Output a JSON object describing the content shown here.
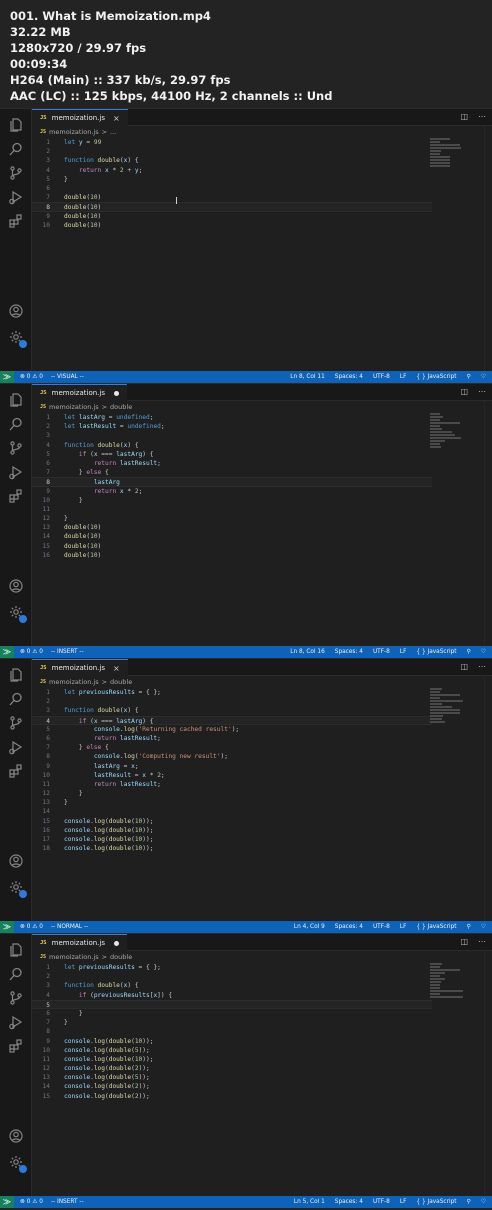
{
  "header": {
    "lines": [
      "001. What is Memoization.mp4",
      "32.22 MB",
      "1280x720 / 29.97 fps",
      "00:09:34",
      "H264 (Main) :: 337 kb/s, 29.97 fps",
      "AAC (LC) :: 125 kbps, 44100 Hz, 2 channels :: Und"
    ]
  },
  "colors": {
    "status_bar": "#0e62b8",
    "remote_indicator": "#16825d",
    "editor_bg": "#1f1f1f",
    "activity_bar": "#181818",
    "keyword": "#569cd6",
    "function": "#dcdcaa",
    "string": "#ce9178",
    "number": "#b5cea8",
    "variable": "#9cdcfe",
    "control": "#c586c0"
  },
  "activity_icons": [
    "files-icon",
    "search-icon",
    "source-control-icon",
    "run-debug-icon",
    "extensions-icon",
    "account-icon",
    "settings-gear-icon"
  ],
  "panels": [
    {
      "tab": {
        "icon": "JS",
        "filename": "memoization.js",
        "modified": false,
        "close": "×"
      },
      "breadcrumb": {
        "file": "memoization.js",
        "sep": ">",
        "symbol": "..."
      },
      "lines": [
        {
          "n": "1",
          "text": "let y = 99"
        },
        {
          "n": "2",
          "text": ""
        },
        {
          "n": "3",
          "text": "function double(x) {"
        },
        {
          "n": "4",
          "text": "    return x * 2 + y;"
        },
        {
          "n": "5",
          "text": "}"
        },
        {
          "n": "6",
          "text": ""
        },
        {
          "n": "7",
          "text": "double(10)"
        },
        {
          "n": "8",
          "text": "double(10)"
        },
        {
          "n": "9",
          "text": "double(10)"
        },
        {
          "n": "10",
          "text": "double(10)"
        }
      ],
      "active_line": 8,
      "status": {
        "mode": "-- VISUAL --",
        "problems": "⊗ 0 ⚠ 0",
        "position": "Ln 8, Col 11",
        "spaces": "Spaces: 4",
        "encoding": "UTF-8",
        "eol": "LF",
        "language": "{ } JavaScript"
      }
    },
    {
      "tab": {
        "icon": "JS",
        "filename": "memoization.js",
        "modified": true,
        "close": ""
      },
      "breadcrumb": {
        "file": "memoization.js",
        "sep": ">",
        "symbol": "double"
      },
      "lines": [
        {
          "n": "1",
          "text": "let lastArg = undefined;"
        },
        {
          "n": "2",
          "text": "let lastResult = undefined;"
        },
        {
          "n": "3",
          "text": ""
        },
        {
          "n": "4",
          "text": "function double(x) {"
        },
        {
          "n": "5",
          "text": "    if (x === lastArg) {"
        },
        {
          "n": "6",
          "text": "        return lastResult;"
        },
        {
          "n": "7",
          "text": "    } else {"
        },
        {
          "n": "8",
          "text": "        lastArg"
        },
        {
          "n": "9",
          "text": "        return x * 2;"
        },
        {
          "n": "10",
          "text": "    }"
        },
        {
          "n": "11",
          "text": ""
        },
        {
          "n": "12",
          "text": "}"
        },
        {
          "n": "13",
          "text": "double(10)"
        },
        {
          "n": "14",
          "text": "double(10)"
        },
        {
          "n": "15",
          "text": "double(10)"
        },
        {
          "n": "16",
          "text": "double(10)"
        }
      ],
      "active_line": 8,
      "status": {
        "mode": "-- INSERT --",
        "problems": "⊗ 0 ⚠ 0",
        "position": "Ln 8, Col 16",
        "spaces": "Spaces: 4",
        "encoding": "UTF-8",
        "eol": "LF",
        "language": "{ } JavaScript"
      }
    },
    {
      "tab": {
        "icon": "JS",
        "filename": "memoization.js",
        "modified": false,
        "close": "×"
      },
      "breadcrumb": {
        "file": "memoization.js",
        "sep": ">",
        "symbol": "double"
      },
      "lines": [
        {
          "n": "1",
          "text": "let previousResults = { };"
        },
        {
          "n": "2",
          "text": ""
        },
        {
          "n": "3",
          "text": "function double(x) {"
        },
        {
          "n": "4",
          "text": "    if (x === lastArg) {"
        },
        {
          "n": "5",
          "text": "        console.log('Returning cached result');"
        },
        {
          "n": "6",
          "text": "        return lastResult;"
        },
        {
          "n": "7",
          "text": "    } else {"
        },
        {
          "n": "8",
          "text": "        console.log('Computing new result');"
        },
        {
          "n": "9",
          "text": "        lastArg = x;"
        },
        {
          "n": "10",
          "text": "        lastResult = x * 2;"
        },
        {
          "n": "11",
          "text": "        return lastResult;"
        },
        {
          "n": "12",
          "text": "    }"
        },
        {
          "n": "13",
          "text": "}"
        },
        {
          "n": "14",
          "text": ""
        },
        {
          "n": "15",
          "text": "console.log(double(10));"
        },
        {
          "n": "16",
          "text": "console.log(double(10));"
        },
        {
          "n": "17",
          "text": "console.log(double(10));"
        },
        {
          "n": "18",
          "text": "console.log(double(10));"
        }
      ],
      "active_line": 4,
      "status": {
        "mode": "-- NORMAL --",
        "problems": "⊗ 0 ⚠ 0",
        "position": "Ln 4, Col 9",
        "spaces": "Spaces: 4",
        "encoding": "UTF-8",
        "eol": "LF",
        "language": "{ } JavaScript"
      }
    },
    {
      "tab": {
        "icon": "JS",
        "filename": "memoization.js",
        "modified": true,
        "close": ""
      },
      "breadcrumb": {
        "file": "memoization.js",
        "sep": ">",
        "symbol": "double"
      },
      "lines": [
        {
          "n": "1",
          "text": "let previousResults = { };"
        },
        {
          "n": "2",
          "text": ""
        },
        {
          "n": "3",
          "text": "function double(x) {"
        },
        {
          "n": "4",
          "text": "    if (previousResults[x]) {"
        },
        {
          "n": "5",
          "text": ""
        },
        {
          "n": "6",
          "text": "    }"
        },
        {
          "n": "7",
          "text": "}"
        },
        {
          "n": "8",
          "text": ""
        },
        {
          "n": "9",
          "text": "console.log(double(10));"
        },
        {
          "n": "10",
          "text": "console.log(double(5));"
        },
        {
          "n": "11",
          "text": "console.log(double(10));"
        },
        {
          "n": "12",
          "text": "console.log(double(2));"
        },
        {
          "n": "13",
          "text": "console.log(double(5));"
        },
        {
          "n": "14",
          "text": "console.log(double(2));"
        },
        {
          "n": "15",
          "text": "console.log(double(2));"
        }
      ],
      "active_line": 5,
      "status": {
        "mode": "-- INSERT --",
        "problems": "⊗ 0 ⚠ 0",
        "position": "Ln 5, Col 1",
        "spaces": "Spaces: 4",
        "encoding": "UTF-8",
        "eol": "LF",
        "language": "{ } JavaScript"
      }
    }
  ]
}
